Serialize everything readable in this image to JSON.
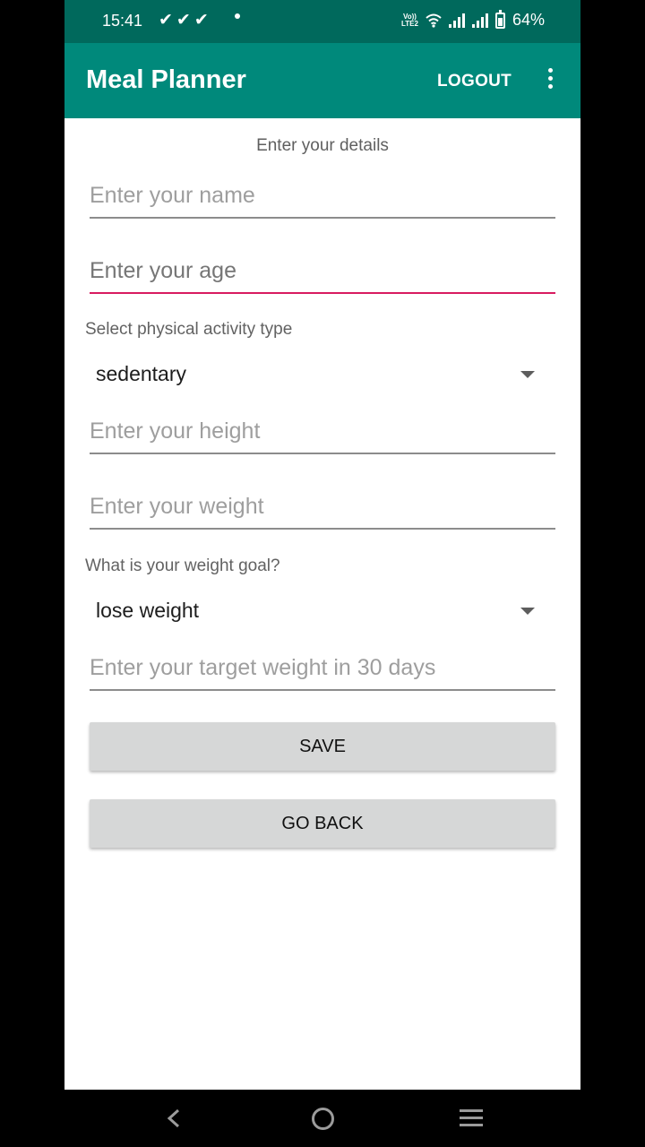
{
  "status_bar": {
    "time": "15:41",
    "checks": "✔✔✔",
    "volte_line1": "Vo))",
    "volte_line2": "LTE2",
    "battery_percent": "64%"
  },
  "app_bar": {
    "title": "Meal Planner",
    "logout_label": "LOGOUT",
    "overflow_icon": "more-vert-icon"
  },
  "form": {
    "heading": "Enter your details",
    "name_placeholder": "Enter your name",
    "age_placeholder": "Enter your age",
    "activity_label": "Select physical activity type",
    "activity_value": "sedentary",
    "height_placeholder": "Enter your height",
    "weight_placeholder": "Enter your weight",
    "goal_label": "What is your weight goal?",
    "goal_value": "lose weight",
    "target_placeholder": "Enter your target weight in 30 days",
    "save_label": "SAVE",
    "go_back_label": "GO BACK"
  },
  "colors": {
    "status_bar": "#00695c",
    "app_bar": "#00897b",
    "focus_accent": "#d81b60",
    "button_bg": "#d6d7d7"
  }
}
